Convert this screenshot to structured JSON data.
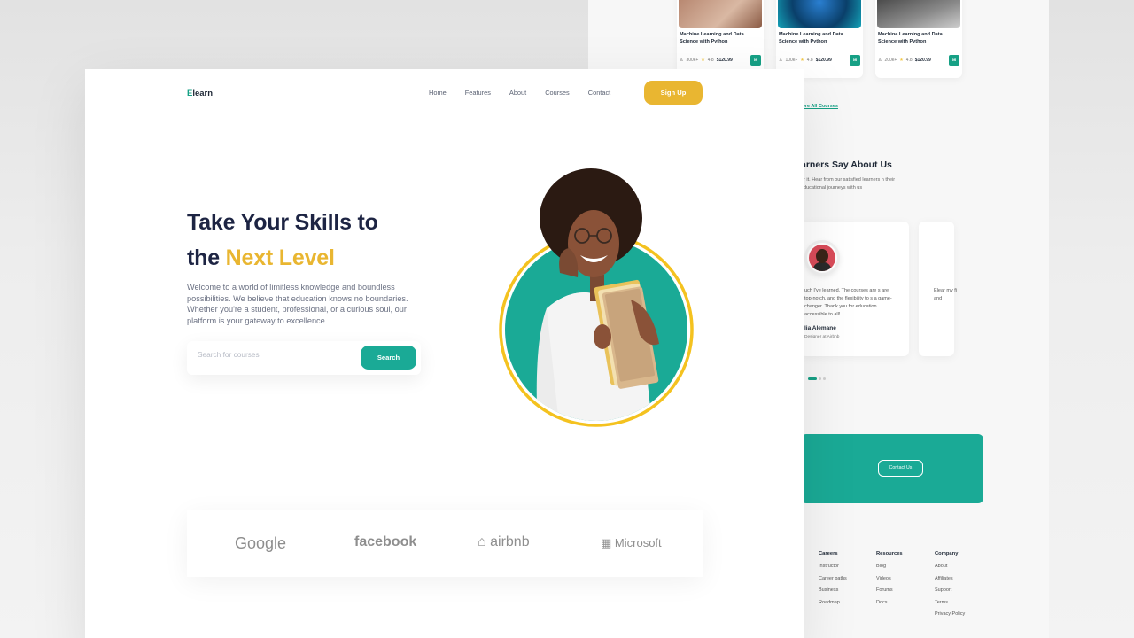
{
  "back_page": {
    "courses": [
      {
        "title": "Machine Learning and Data Science with Python",
        "students": "300k+",
        "rating": "4.8",
        "price": "$120.99"
      },
      {
        "title": "Machine Learning and Data Science with Python",
        "students": "100k+",
        "rating": "4.8",
        "price": "$120.99"
      },
      {
        "title": "Machine Learning and Data Science with Python",
        "students": "200k+",
        "rating": "4.8",
        "price": "$120.99"
      }
    ],
    "explore_link": "lore All Courses",
    "reviews_title": "arners Say About Us",
    "reviews_subtitle": "or it. Hear from our satisfied learners n their educational journeys with us",
    "review": {
      "text": "uch I've learned. The courses are s are top-notch, and the flexibility to s a game-changer. Thank you for education accessible to all!",
      "name": "lia Alemane",
      "role": "Designer at Airbnb"
    },
    "review2_text": "Elear my fi and",
    "contact_button": "Contact Us",
    "footer": [
      {
        "heading": "Careers",
        "items": [
          "Instructor",
          "Career paths",
          "Business",
          "Roadmap"
        ]
      },
      {
        "heading": "Resources",
        "items": [
          "Blog",
          "Videos",
          "Forums",
          "Docs"
        ]
      },
      {
        "heading": "Company",
        "items": [
          "About",
          "Affiliates",
          "Support",
          "Terms",
          "Privacy Policy"
        ]
      }
    ]
  },
  "header": {
    "logo_first": "E",
    "logo_rest": "learn",
    "nav": [
      "Home",
      "Features",
      "About",
      "Courses",
      "Contact"
    ],
    "signup": "Sign Up"
  },
  "hero": {
    "title_line1": "Take Your Skills to",
    "title_line2_plain": "the ",
    "title_line2_highlight": "Next Level",
    "description": "Welcome to a world of limitless knowledge and boundless possibilities. We believe that education knows no boundaries. Whether you're a student, professional, or a curious soul, our platform is your gateway to excellence.",
    "search_placeholder": "Search for courses",
    "search_button": "Search"
  },
  "partners": [
    "Google",
    "facebook",
    "airbnb",
    "Microsoft"
  ],
  "colors": {
    "accent_green": "#1aaa96",
    "accent_yellow": "#e9b631",
    "heading": "#1d2443"
  }
}
